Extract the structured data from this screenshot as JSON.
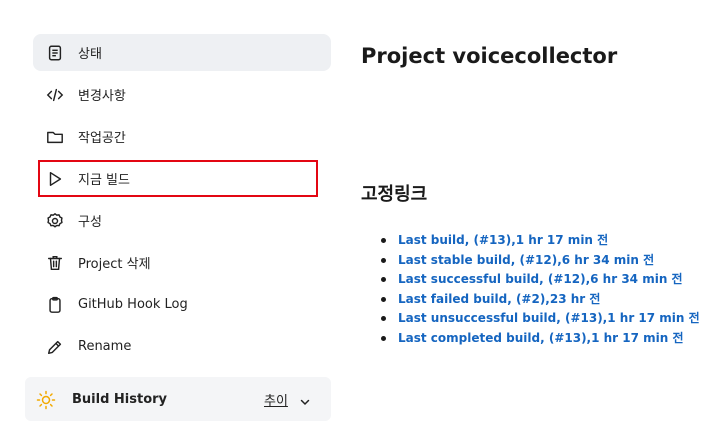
{
  "sidebar": {
    "items": [
      {
        "label": "상태",
        "icon": "document-icon"
      },
      {
        "label": "변경사항",
        "icon": "code-icon"
      },
      {
        "label": "작업공간",
        "icon": "folder-icon"
      },
      {
        "label": "지금 빌드",
        "icon": "play-icon"
      },
      {
        "label": "구성",
        "icon": "gear-icon"
      },
      {
        "label": "Project 삭제",
        "icon": "trash-icon"
      },
      {
        "label": "GitHub Hook Log",
        "icon": "clipboard-icon"
      },
      {
        "label": "Rename",
        "icon": "pencil-icon"
      }
    ]
  },
  "build_history": {
    "title": "Build History",
    "trend_label": "추이",
    "icon": "sun-icon"
  },
  "main": {
    "title": "Project voicecollector",
    "permalinks_heading": "고정링크",
    "permalinks": [
      "Last build, (#13),1 hr 17 min 전",
      "Last stable build, (#12),6 hr 34 min 전",
      "Last successful build, (#12),6 hr 34 min 전",
      "Last failed build, (#2),23 hr 전",
      "Last unsuccessful build, (#13),1 hr 17 min 전",
      "Last completed build, (#13),1 hr 17 min 전"
    ]
  },
  "colors": {
    "link": "#1565c0",
    "highlight_border": "#e30613",
    "active_bg": "#eef0f3",
    "build_history_bg": "#f4f5f7"
  }
}
